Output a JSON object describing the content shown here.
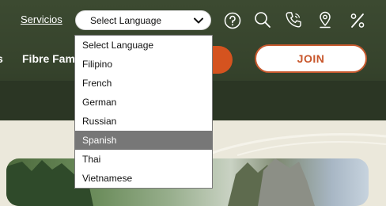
{
  "header": {
    "services_link": "Servicios",
    "language_select": {
      "value": "Select Language"
    },
    "nav_partial_label": "Fibre Fam",
    "join_label": "JOIN"
  },
  "language_dropdown": {
    "options": [
      {
        "label": "Select Language"
      },
      {
        "label": "Filipino"
      },
      {
        "label": "French"
      },
      {
        "label": "German"
      },
      {
        "label": "Russian"
      },
      {
        "label": "Spanish",
        "highlighted": true
      },
      {
        "label": "Thai"
      },
      {
        "label": "Vietnamese"
      }
    ]
  },
  "icons": [
    "help-icon",
    "search-icon",
    "phone-icon",
    "location-pin-icon",
    "percent-icon"
  ],
  "colors": {
    "header_green": "#3c4a31",
    "accent_orange": "#d5531f",
    "page_bg": "#ebe8db",
    "highlight_gray": "#777777"
  }
}
